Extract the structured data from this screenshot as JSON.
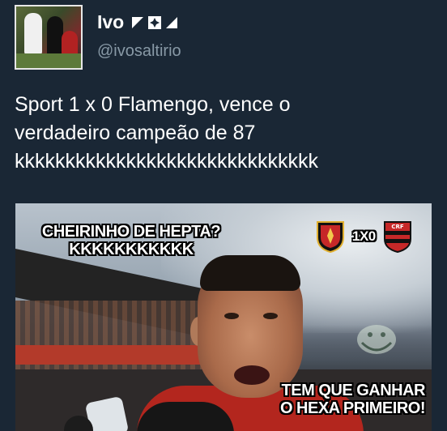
{
  "tweet": {
    "display_name": "Ivo",
    "handle": "@ivosaltirio",
    "text_lines": [
      "Sport 1 x 0 Flamengo, vence o",
      "verdadeiro campeão de 87",
      "kkkkkkkkkkkkkkkkkkkkkkkkkkkkkk"
    ]
  },
  "meme": {
    "top_text_lines": [
      "CHEIRINHO DE HEPTA?",
      "KKKKKKKKKKK"
    ],
    "score": "1X0",
    "bottom_text_lines": [
      "TEM QUE GANHAR",
      "O HEXA PRIMEIRO!"
    ]
  },
  "colors": {
    "background": "#1a2735",
    "handle": "#8899a6",
    "text": "#ffffff"
  },
  "icons": {
    "badges": [
      "flag-corner-icon",
      "cross-icon",
      "flag-triangle-icon"
    ],
    "left_crest": "sport-crest-icon",
    "right_crest": "flamengo-crest-icon"
  }
}
